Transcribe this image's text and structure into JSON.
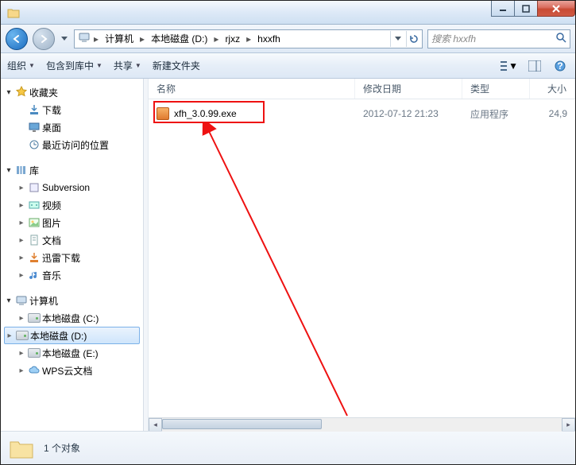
{
  "breadcrumb": {
    "root_icon": "computer",
    "items": [
      "计算机",
      "本地磁盘 (D:)",
      "rjxz",
      "hxxfh"
    ]
  },
  "search": {
    "placeholder": "搜索 hxxfh"
  },
  "toolbar": {
    "organize": "组织",
    "include": "包含到库中",
    "share": "共享",
    "new_folder": "新建文件夹"
  },
  "columns": {
    "name": "名称",
    "date": "修改日期",
    "type": "类型",
    "size": "大小"
  },
  "files": [
    {
      "name": "xfh_3.0.99.exe",
      "date": "2012-07-12 21:23",
      "type": "应用程序",
      "size": "24,9"
    }
  ],
  "sidebar": {
    "favorites": {
      "label": "收藏夹",
      "items": [
        {
          "label": "下载",
          "icon": "download"
        },
        {
          "label": "桌面",
          "icon": "desktop"
        },
        {
          "label": "最近访问的位置",
          "icon": "recent"
        }
      ]
    },
    "libraries": {
      "label": "库",
      "items": [
        {
          "label": "Subversion",
          "icon": "svn"
        },
        {
          "label": "视频",
          "icon": "video"
        },
        {
          "label": "图片",
          "icon": "picture"
        },
        {
          "label": "文档",
          "icon": "doc"
        },
        {
          "label": "迅雷下载",
          "icon": "xunlei"
        },
        {
          "label": "音乐",
          "icon": "music"
        }
      ]
    },
    "computer": {
      "label": "计算机",
      "items": [
        {
          "label": "本地磁盘 (C:)",
          "selected": false
        },
        {
          "label": "本地磁盘 (D:)",
          "selected": true
        },
        {
          "label": "本地磁盘 (E:)",
          "selected": false
        },
        {
          "label": "WPS云文档",
          "selected": false,
          "icon": "cloud"
        }
      ]
    }
  },
  "status": {
    "count_label": "1 个对象"
  }
}
